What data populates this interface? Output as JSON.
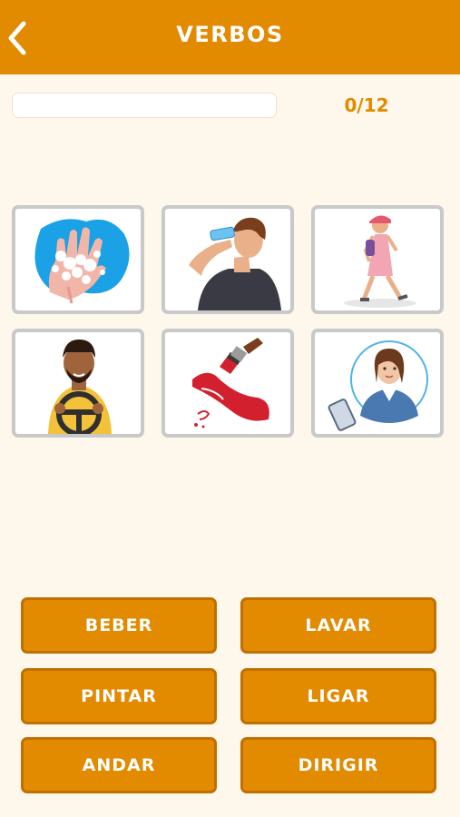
{
  "header": {
    "title": "VERBOS",
    "back_icon": "chevron-left-icon"
  },
  "progress": {
    "current_text": "0/12",
    "fraction": 0
  },
  "colors": {
    "accent": "#e28a00",
    "background": "#fdf7ec",
    "card_border": "#c9c9c9"
  },
  "cards": [
    {
      "image": "washing-hands-illustration"
    },
    {
      "image": "man-drinking-water-illustration"
    },
    {
      "image": "woman-walking-illustration"
    },
    {
      "image": "man-driving-steering-wheel-illustration"
    },
    {
      "image": "paint-brush-illustration"
    },
    {
      "image": "woman-phone-call-illustration"
    }
  ],
  "answers": [
    {
      "label": "BEBER"
    },
    {
      "label": "LAVAR"
    },
    {
      "label": "PINTAR"
    },
    {
      "label": "LIGAR"
    },
    {
      "label": "ANDAR"
    },
    {
      "label": "DIRIGIR"
    }
  ]
}
